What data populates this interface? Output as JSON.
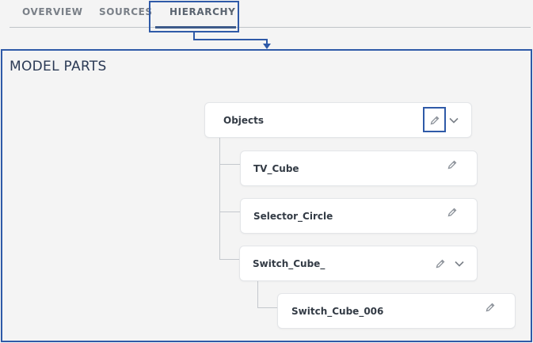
{
  "tabs": [
    {
      "label": "OVERVIEW",
      "active": false
    },
    {
      "label": "SOURCES",
      "active": false
    },
    {
      "label": "HIERARCHY",
      "active": true
    }
  ],
  "panel": {
    "title": "MODEL PARTS"
  },
  "tree": {
    "root": {
      "label": "Objects",
      "expanded": true
    },
    "children": [
      {
        "label": "TV_Cube"
      },
      {
        "label": "Selector_Circle"
      },
      {
        "label": "Switch_Cube_",
        "expanded": true
      }
    ],
    "grandchildren": [
      {
        "label": "Switch_Cube_006"
      }
    ]
  },
  "colors": {
    "highlight": "#2f5aa8",
    "accent": "#3d5a8a"
  },
  "icons": {
    "edit": "pencil-icon",
    "expand": "chevron-down-icon"
  }
}
